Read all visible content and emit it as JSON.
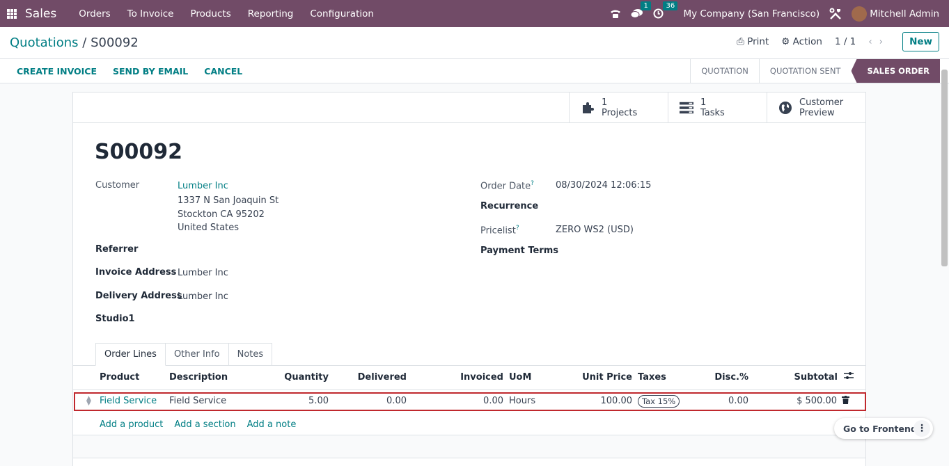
{
  "topbar": {
    "app_name": "Sales",
    "menu": [
      "Orders",
      "To Invoice",
      "Products",
      "Reporting",
      "Configuration"
    ],
    "messages_count": "1",
    "activities_count": "36",
    "company": "My Company (San Francisco)",
    "user": "Mitchell Admin",
    "bg_color": "#714b67"
  },
  "breadcrumb": {
    "parent": "Quotations",
    "separator": "/",
    "current": "S00092"
  },
  "control": {
    "print": "Print",
    "action": "Action",
    "pager": "1 / 1",
    "new": "New"
  },
  "actions": {
    "create_invoice": "CREATE INVOICE",
    "send_email": "SEND BY EMAIL",
    "cancel": "CANCEL"
  },
  "stages": [
    "QUOTATION",
    "QUOTATION SENT",
    "SALES ORDER"
  ],
  "active_stage": "SALES ORDER",
  "smart_buttons": [
    {
      "count": "1",
      "label": "Projects",
      "icon": "puzzle-icon"
    },
    {
      "count": "1",
      "label": "Tasks",
      "icon": "tasks-icon"
    },
    {
      "line1": "Customer",
      "line2": "Preview",
      "icon": "globe-icon"
    }
  ],
  "form": {
    "title": "S00092",
    "customer_label": "Customer",
    "customer_name": "Lumber Inc",
    "customer_addr1": "1337 N San Joaquin St",
    "customer_addr2": "Stockton CA 95202",
    "customer_addr3": "United States",
    "referrer_label": "Referrer",
    "invoice_label": "Invoice Address",
    "invoice_value": "Lumber Inc",
    "delivery_label": "Delivery Address",
    "delivery_value": "Lumber Inc",
    "studio_label": "Studio1",
    "order_date_label": "Order Date",
    "order_date_value": "08/30/2024 12:06:15",
    "recurrence_label": "Recurrence",
    "pricelist_label": "Pricelist",
    "pricelist_value": "ZERO WS2 (USD)",
    "payment_terms_label": "Payment Terms",
    "help_mark": "?"
  },
  "tabs": [
    "Order Lines",
    "Other Info",
    "Notes"
  ],
  "table": {
    "headers": [
      "Product",
      "Description",
      "Quantity",
      "Delivered",
      "Invoiced",
      "UoM",
      "Unit Price",
      "Taxes",
      "Disc.%",
      "Subtotal"
    ],
    "rows": [
      {
        "product": "Field Service",
        "description": "Field Service",
        "quantity": "5.00",
        "delivered": "0.00",
        "invoiced": "0.00",
        "uom": "Hours",
        "unit_price": "100.00",
        "taxes": "Tax 15%",
        "disc": "0.00",
        "subtotal": "$ 500.00"
      }
    ],
    "add_product": "Add a product",
    "add_section": "Add a section",
    "add_note": "Add a note"
  },
  "floating": {
    "go_frontend": "Go to Frontend"
  }
}
